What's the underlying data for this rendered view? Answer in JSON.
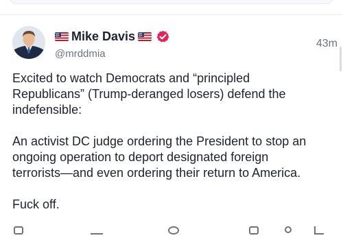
{
  "post": {
    "display_name": "Mike Davis",
    "handle": "@mrddmia",
    "timestamp": "43m",
    "verified_icon": "verified-badge-icon",
    "flag_icon": "us-flag-icon",
    "paragraphs": [
      "Excited to watch Democrats and “principled\nRepublicans” (Trump-deranged losers) defend the\nindefensible:",
      "An activist DC judge ordering the President to stop an\nongoing operation to deport designated foreign\nterrorists—and even ordering their return to America.",
      "Fuck off."
    ]
  },
  "actions": {
    "icons": [
      "reply-icon",
      "repost-icon",
      "like-icon",
      "bookmark-icon",
      "more-icon",
      "share-icon"
    ]
  },
  "colors": {
    "accent": "#e0245e",
    "text": "#1d2230",
    "muted": "#6b7280",
    "divider": "#eceef3"
  }
}
